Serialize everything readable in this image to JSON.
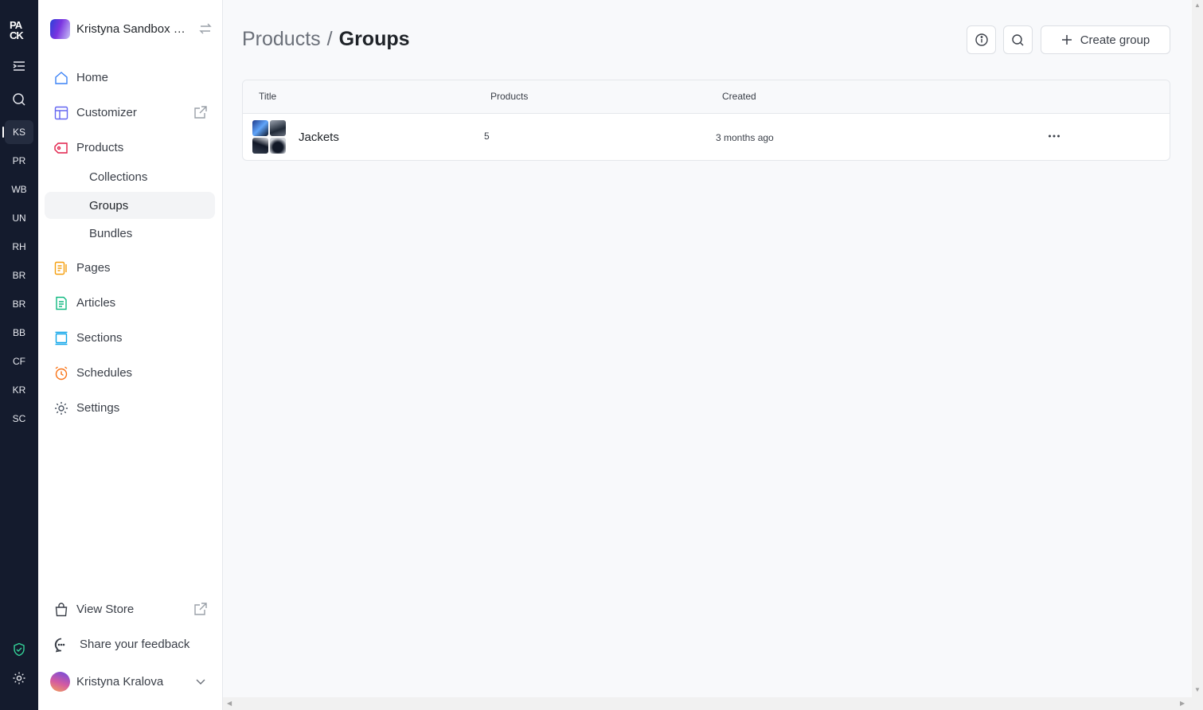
{
  "rail": {
    "logo_text": "PACK",
    "stores": [
      "KS",
      "PR",
      "WB",
      "UN",
      "RH",
      "BR",
      "BR",
      "BB",
      "CF",
      "KR",
      "SC"
    ],
    "active_store": "KS"
  },
  "sidebar": {
    "workspace_name": "Kristyna Sandbox S...",
    "nav": {
      "home": "Home",
      "customizer": "Customizer",
      "products": "Products",
      "collections": "Collections",
      "groups": "Groups",
      "bundles": "Bundles",
      "pages": "Pages",
      "articles": "Articles",
      "sections": "Sections",
      "schedules": "Schedules",
      "settings": "Settings"
    },
    "view_store": "View Store",
    "feedback": "Share your feedback",
    "user_name": "Kristyna Kralova"
  },
  "header": {
    "breadcrumb_parent": "Products",
    "breadcrumb_separator": "/",
    "title": "Groups",
    "create_label": "Create group"
  },
  "table": {
    "columns": {
      "title": "Title",
      "products": "Products",
      "created": "Created"
    },
    "rows": [
      {
        "title": "Jackets",
        "products": "5",
        "created": "3 months ago"
      }
    ]
  },
  "colors": {
    "rail_bg": "#141b2d",
    "home": "#3b82f6",
    "customizer": "#6366f1",
    "products": "#e11d48",
    "pages": "#f59e0b",
    "articles": "#10b981",
    "sections": "#0ea5e9",
    "schedules": "#f97316",
    "settings": "#4b5563"
  }
}
